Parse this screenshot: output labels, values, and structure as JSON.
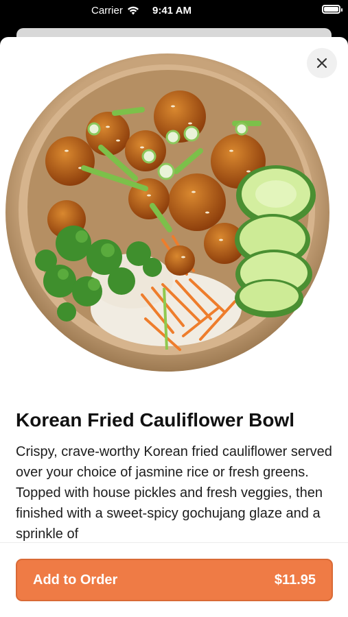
{
  "status_bar": {
    "carrier": "Carrier",
    "time": "9:41 AM",
    "wifi_icon": "wifi-icon",
    "battery_icon": "battery-icon"
  },
  "modal": {
    "close_icon": "close-icon",
    "image_subject": "food-bowl-photo",
    "title": "Korean Fried Cauliflower Bowl",
    "description": "Crispy, crave-worthy Korean fried cauliflower served over your choice of jasmine rice or fresh greens. Topped with house pickles and fresh veggies, then finished with a sweet-spicy gochujang glaze and a sprinkle of"
  },
  "footer": {
    "add_label": "Add to Order",
    "price": "$11.95"
  },
  "colors": {
    "accent": "#ef7b45",
    "accent_border": "#d96a36"
  }
}
